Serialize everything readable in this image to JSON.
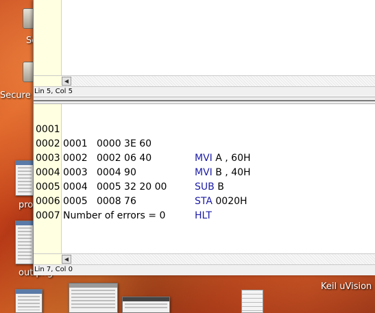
{
  "desktop": {
    "icons": [
      {
        "label": "Se"
      },
      {
        "label": "Secure"
      },
      {
        "label": "pro"
      },
      {
        "label": "out.png"
      },
      {
        "label": "Keil uVision"
      }
    ]
  },
  "editor": {
    "top_status": "Lin 5, Col 5",
    "bottom_status": "Lin 7, Col 0",
    "lines": [
      {
        "num": "0001",
        "text": "0001   0000 3E 60",
        "mnemonic": "MVI",
        "operand": " A , 60H"
      },
      {
        "num": "0002",
        "text": "0002   0002 06 40",
        "mnemonic": "MVI",
        "operand": " B , 40H"
      },
      {
        "num": "0003",
        "text": "0003   0004 90",
        "mnemonic": "SUB",
        "operand": " B"
      },
      {
        "num": "0004",
        "text": "0004   0005 32 20 00",
        "mnemonic": "STA",
        "operand": " 0020H"
      },
      {
        "num": "0005",
        "text": "0005   0008 76",
        "mnemonic": "HLT",
        "operand": ""
      },
      {
        "num": "0006",
        "text": "Number of errors = 0",
        "mnemonic": "",
        "operand": ""
      },
      {
        "num": "0007",
        "text": "",
        "mnemonic": "",
        "operand": ""
      }
    ],
    "colors": {
      "gutter": "#ffffe1",
      "mnemonic": "#1a1aa6"
    }
  }
}
